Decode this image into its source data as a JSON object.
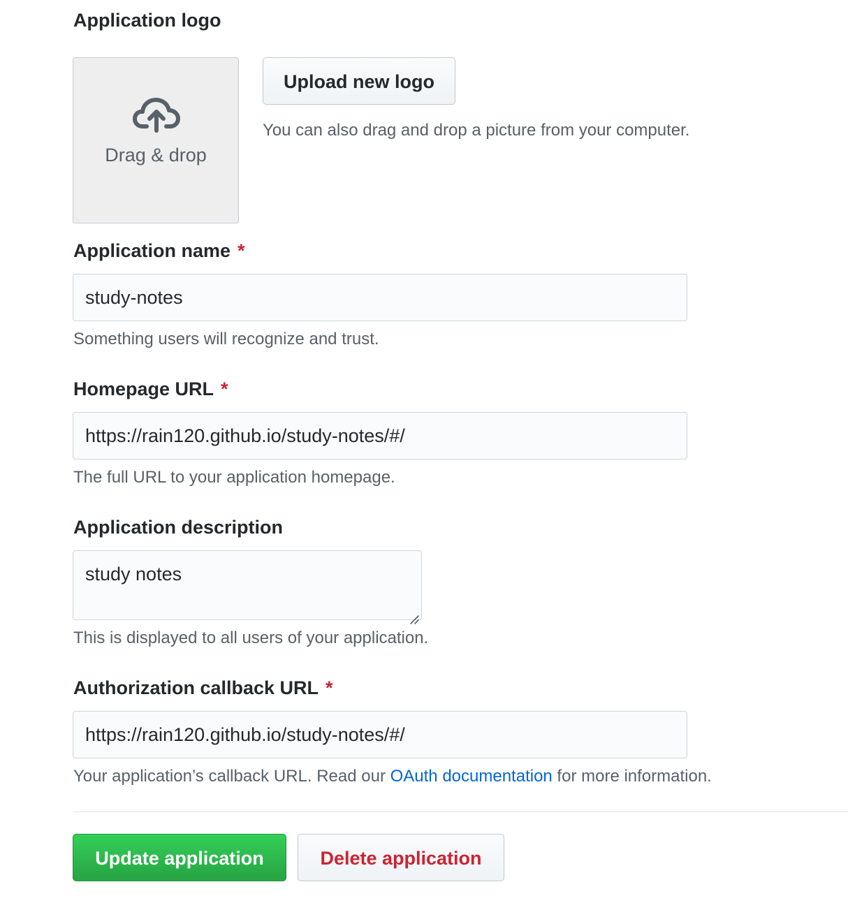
{
  "logo": {
    "label": "Application logo",
    "drop_icon": "cloud-upload-icon",
    "drop_text": "Drag & drop",
    "upload_button": "Upload new logo",
    "upload_note": "You can also drag and drop a picture from your computer."
  },
  "app_name": {
    "label": "Application name",
    "required_mark": "*",
    "value": "study-notes",
    "note": "Something users will recognize and trust."
  },
  "homepage": {
    "label": "Homepage URL",
    "required_mark": "*",
    "value": "https://rain120.github.io/study-notes/#/",
    "note": "The full URL to your application homepage."
  },
  "description": {
    "label": "Application description",
    "value": "study notes",
    "note": "This is displayed to all users of your application."
  },
  "callback": {
    "label": "Authorization callback URL",
    "required_mark": "*",
    "value": "https://rain120.github.io/study-notes/#/",
    "note_before": "Your application’s callback URL. Read our ",
    "note_link": "OAuth documentation",
    "note_after": " for more information."
  },
  "actions": {
    "update": "Update application",
    "delete": "Delete application"
  },
  "colors": {
    "primary_green": "#28a745",
    "danger_red": "#cb2431",
    "link_blue": "#0366d6"
  }
}
